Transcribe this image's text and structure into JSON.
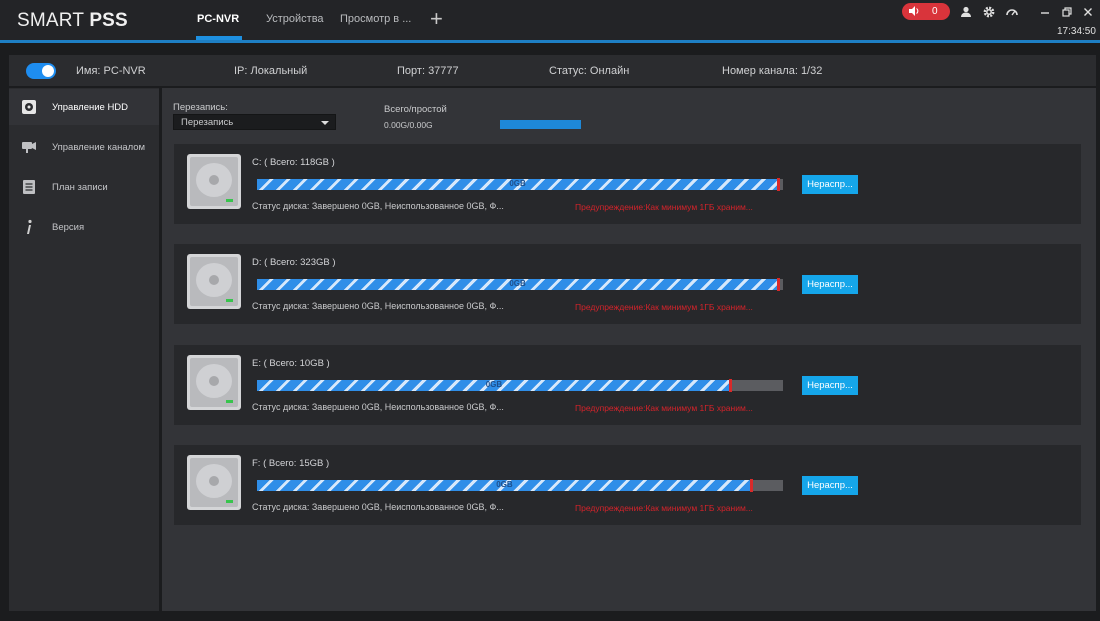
{
  "app": {
    "brand_smart": "SMART",
    "brand_pss": "PSS"
  },
  "tabs": [
    {
      "label": "PC-NVR"
    },
    {
      "label": "Устройства"
    },
    {
      "label": "Просмотр в ..."
    }
  ],
  "tab_add_symbol": "+",
  "topbar": {
    "alarm_count": "0",
    "clock": "17:34:50"
  },
  "infobar": {
    "name_label": "Имя:",
    "name_value": "PC-NVR",
    "ip_label": "IP:",
    "ip_value": "Локальный",
    "port_label": "Порт:",
    "port_value": "37777",
    "status_label": "Статус:",
    "status_value": "Онлайн",
    "channel_label": "Номер канала:",
    "channel_value": "1/32"
  },
  "sidebar": {
    "items": [
      {
        "label": "Управление HDD",
        "icon": "hdd-icon"
      },
      {
        "label": "Управление каналом",
        "icon": "camera-icon"
      },
      {
        "label": "План записи",
        "icon": "schedule-icon"
      },
      {
        "label": "Версия",
        "icon": "info-icon"
      }
    ]
  },
  "main": {
    "overwrite_label": "Перезапись:",
    "overwrite_value": "Перезапись",
    "total_label": "Всего/простой",
    "total_value": "0.00G/0.00G"
  },
  "disks": [
    {
      "title": "C: ( Всего: 118GB )",
      "bar_text": "0GB",
      "used_fraction": 0.99,
      "status": "Статус диска:  Завершено 0GB, Неиспользованное 0GB, Ф...",
      "warning": "Предупреждение:Как минимум 1ГБ храним...",
      "button": "Нераспр..."
    },
    {
      "title": "D: ( Всего: 323GB )",
      "bar_text": "0GB",
      "used_fraction": 0.99,
      "status": "Статус диска:  Завершено 0GB, Неиспользованное 0GB, Ф...",
      "warning": "Предупреждение:Как минимум 1ГБ храним...",
      "button": "Нераспр..."
    },
    {
      "title": "E: ( Всего: 10GB )",
      "bar_text": "0GB",
      "used_fraction": 0.9,
      "status": "Статус диска:  Завершено 0GB, Неиспользованное 0GB, Ф...",
      "warning": "Предупреждение:Как минимум 1ГБ храним...",
      "button": "Нераспр..."
    },
    {
      "title": "F: ( Всего: 15GB )",
      "bar_text": "0GB",
      "used_fraction": 0.94,
      "status": "Статус диска:  Завершено 0GB, Неиспользованное 0GB, Ф...",
      "warning": "Предупреждение:Как минимум 1ГБ храним...",
      "button": "Нераспр..."
    }
  ],
  "colors": {
    "accent": "#1e88d8",
    "button": "#15a6ea",
    "warning": "#d4232b",
    "alarm": "#d9343b"
  }
}
